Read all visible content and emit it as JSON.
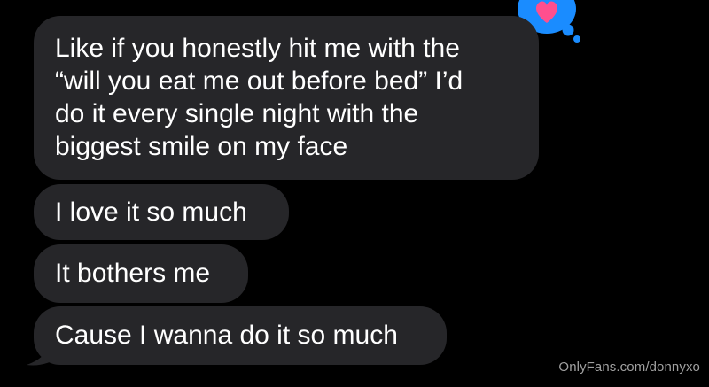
{
  "messages": [
    {
      "lines": [
        "Like if you honestly hit me with the",
        "“will you eat me out before bed” I’d",
        "do it every single night with the",
        "biggest smile on my face"
      ]
    },
    {
      "text": "I love it so much"
    },
    {
      "text": "It bothers me"
    },
    {
      "text": "Cause I wanna do it so much"
    }
  ],
  "reaction": {
    "icon": "heart-icon",
    "badge_color": "#1a8cff",
    "heart_color": "#ff4f8e"
  },
  "bubble_color": "#262629",
  "watermark": "OnlyFans.com/donnyxo"
}
